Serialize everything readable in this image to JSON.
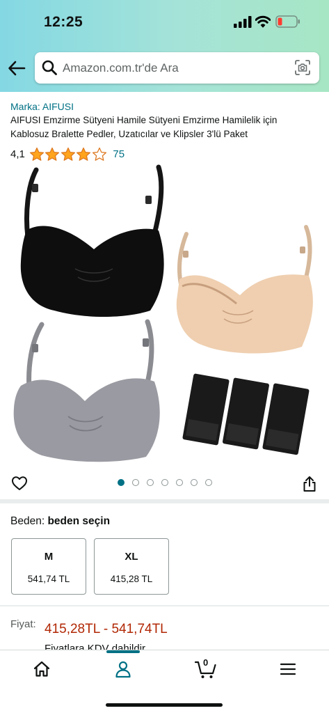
{
  "status_bar": {
    "time": "12:25"
  },
  "search": {
    "placeholder": "Amazon.com.tr'de Ara"
  },
  "product": {
    "brand": "Marka: AIFUSI",
    "title": "AIFUSI Emzirme Sütyeni Hamile Sütyeni Emzirme Hamilelik için Kablosuz Bralette Pedler, Uzatıcılar ve Klipsler 3'lü Paket",
    "rating_value": "4,1",
    "rating_stars": 4.1,
    "rating_count": "75"
  },
  "gallery": {
    "image_count": 7,
    "active_index": 0
  },
  "size": {
    "label": "Beden:",
    "value": "beden seçin",
    "options": [
      {
        "name": "M",
        "price": "541,74 TL"
      },
      {
        "name": "XL",
        "price": "415,28 TL"
      }
    ]
  },
  "price": {
    "label": "Fiyat:",
    "range": "415,28TL - 541,74TL",
    "note": "Fiyatlara KDV dahildir"
  },
  "tabbar": {
    "active_tab": "account",
    "cart_count": "0"
  },
  "colors": {
    "link": "#007185",
    "price": "#b12704",
    "header_gradient_start": "#84d8e3",
    "header_gradient_end": "#a7e6c4"
  },
  "icons": [
    "back-arrow-icon",
    "search-icon",
    "camera-icon",
    "heart-icon",
    "share-icon",
    "home-icon",
    "account-icon",
    "cart-icon",
    "menu-icon"
  ]
}
